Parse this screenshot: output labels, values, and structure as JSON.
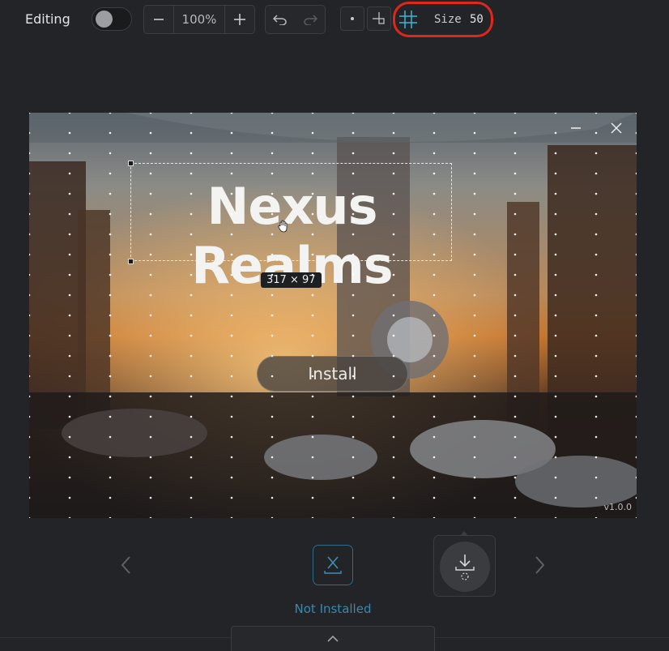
{
  "toolbar": {
    "editing_label": "Editing",
    "editing_toggle_on": false,
    "zoom_value": "100%",
    "grid_size_label": "Size",
    "grid_size_value": "50"
  },
  "canvas": {
    "logo_text": "Nexus Realms",
    "selection_dimensions": "317 × 97",
    "install_label": "Install",
    "version": "v1.0.0"
  },
  "bottom": {
    "status_label": "Not Installed",
    "status_icon": "x-icon"
  },
  "colors": {
    "highlight": "#e0271b",
    "status_accent": "#3b89ad",
    "background": "#222427"
  }
}
